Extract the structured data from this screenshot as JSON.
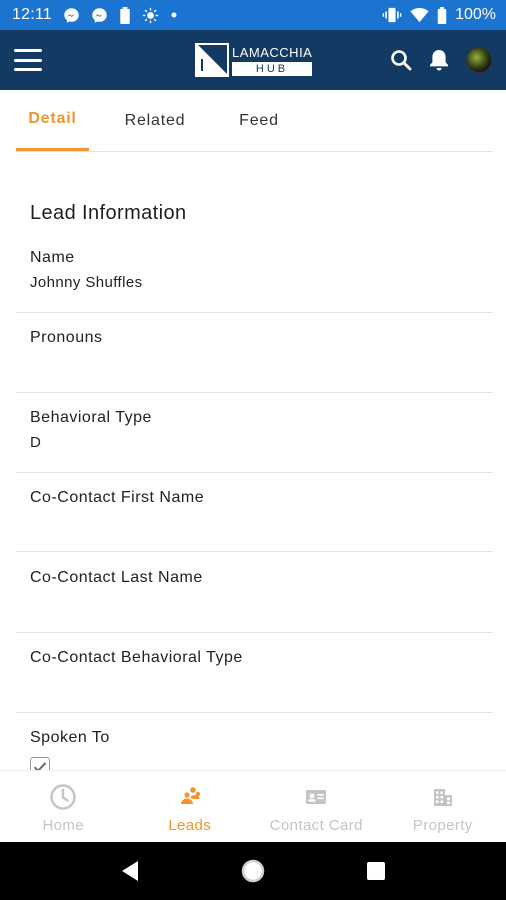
{
  "status_bar": {
    "time": "12:11",
    "battery": "100%",
    "left_icons": [
      "messenger-icon",
      "messenger-icon",
      "battery-saver-icon",
      "sun-icon",
      "dot-icon"
    ],
    "right_icons": [
      "vibrate-icon",
      "wifi-icon",
      "battery-icon"
    ]
  },
  "app_bar": {
    "logo_top": "LAMACCHIA",
    "logo_bottom": "HUB"
  },
  "tabs": [
    {
      "label": "Detail",
      "active": true
    },
    {
      "label": "Related",
      "active": false
    },
    {
      "label": "Feed",
      "active": false
    }
  ],
  "section": {
    "title": "Lead Information"
  },
  "fields": [
    {
      "label": "Name",
      "value": "Johnny Shuffles"
    },
    {
      "label": "Pronouns",
      "value": ""
    },
    {
      "label": "Behavioral Type",
      "value": "D"
    },
    {
      "label": "Co-Contact First Name",
      "value": ""
    },
    {
      "label": "Co-Contact Last Name",
      "value": ""
    },
    {
      "label": "Co-Contact Behavioral Type",
      "value": ""
    },
    {
      "label": "Spoken To",
      "checked": true
    }
  ],
  "bottom_nav": [
    {
      "label": "Home",
      "icon": "clock-icon",
      "active": false
    },
    {
      "label": "Leads",
      "icon": "leads-icon",
      "active": true
    },
    {
      "label": "Contact Card",
      "icon": "contact-card-icon",
      "active": false
    },
    {
      "label": "Property",
      "icon": "building-icon",
      "active": false
    }
  ],
  "colors": {
    "status_bar": "#1b75d0",
    "app_bar": "#123a63",
    "accent": "#f0962f",
    "inactive_nav": "#c4c4c4",
    "divider": "#e3e3e3"
  }
}
